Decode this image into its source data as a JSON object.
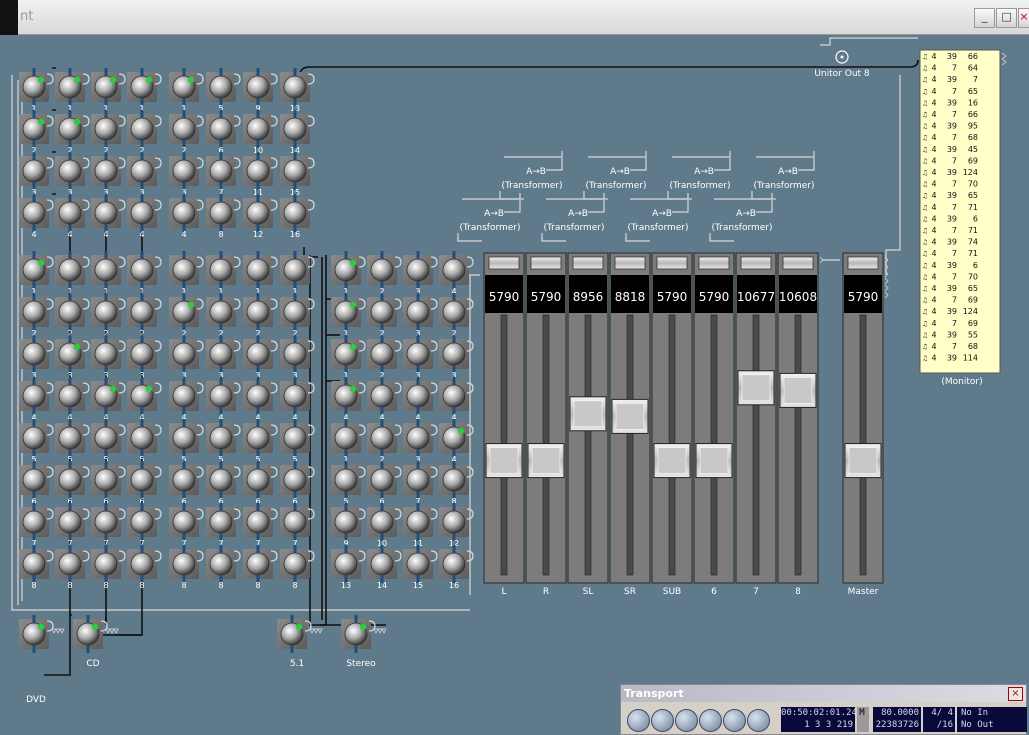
{
  "window": {
    "title": "nt",
    "min_glyph": "_",
    "max_glyph": "□",
    "close_glyph": "×"
  },
  "colors": {
    "background": "#5f7a8a",
    "knob_led": "#2ecc40",
    "fader_panel": "#7c7c7c",
    "readout_bg": "#000000",
    "monitor_bg": "#ffffc8"
  },
  "knob_groups": {
    "block_a_rows": [
      [
        "1",
        "1",
        "1",
        "1"
      ],
      [
        "2",
        "2",
        "2",
        "2"
      ],
      [
        "3",
        "3",
        "3",
        "3"
      ],
      [
        "4",
        "4",
        "4",
        "4"
      ]
    ],
    "block_b_rows": [
      [
        "1",
        "5",
        "9",
        "13"
      ],
      [
        "2",
        "6",
        "10",
        "14"
      ],
      [
        "3",
        "7",
        "11",
        "15"
      ],
      [
        "4",
        "8",
        "12",
        "16"
      ]
    ],
    "block_c_rows": [
      [
        "1",
        "1",
        "1",
        "1"
      ],
      [
        "2",
        "2",
        "2",
        "2"
      ],
      [
        "3",
        "3",
        "3",
        "3"
      ],
      [
        "4",
        "4",
        "4",
        "4"
      ],
      [
        "5",
        "5",
        "5",
        "5"
      ],
      [
        "6",
        "6",
        "6",
        "6"
      ],
      [
        "7",
        "7",
        "7",
        "7"
      ],
      [
        "8",
        "8",
        "8",
        "8"
      ]
    ],
    "block_d_rows": [
      [
        "1",
        "1",
        "1",
        "1"
      ],
      [
        "2",
        "2",
        "2",
        "2"
      ],
      [
        "3",
        "3",
        "3",
        "3"
      ],
      [
        "4",
        "4",
        "4",
        "4"
      ],
      [
        "5",
        "5",
        "5",
        "5"
      ],
      [
        "6",
        "6",
        "6",
        "6"
      ],
      [
        "7",
        "7",
        "7",
        "7"
      ],
      [
        "8",
        "8",
        "8",
        "8"
      ]
    ],
    "block_e_rows": [
      [
        "1",
        "2",
        "3",
        "4"
      ],
      [
        "1",
        "2",
        "3",
        "2"
      ],
      [
        "1",
        "2",
        "3",
        "3"
      ],
      [
        "4",
        "4",
        "4",
        "4"
      ],
      [
        "1",
        "2",
        "3",
        "4"
      ],
      [
        "5",
        "6",
        "7",
        "8"
      ],
      [
        "9",
        "10",
        "11",
        "12"
      ],
      [
        "13",
        "14",
        "15",
        "16"
      ]
    ],
    "block_a_leds": [
      0,
      1,
      2,
      3,
      4,
      5
    ],
    "block_c_leds": [
      0,
      9,
      14,
      15
    ],
    "block_d_leds": [
      4
    ],
    "block_e_leds": [
      0,
      4,
      8,
      12,
      19
    ]
  },
  "sources": [
    {
      "label": "DVD"
    },
    {
      "label": "CD"
    },
    {
      "label": "5.1"
    },
    {
      "label": "Stereo"
    }
  ],
  "unitor_out": "Unitor Out 8",
  "transformer": {
    "glyph": "A→B",
    "label": "(Transformer)"
  },
  "faders": {
    "channels": [
      {
        "label": "L",
        "value": "5790",
        "level": 0.44
      },
      {
        "label": "R",
        "value": "5790",
        "level": 0.44
      },
      {
        "label": "SL",
        "value": "8956",
        "level": 0.62
      },
      {
        "label": "SR",
        "value": "8818",
        "level": 0.61
      },
      {
        "label": "SUB",
        "value": "5790",
        "level": 0.44
      },
      {
        "label": "6",
        "value": "5790",
        "level": 0.44
      },
      {
        "label": "7",
        "value": "10677",
        "level": 0.72
      },
      {
        "label": "8",
        "value": "10608",
        "level": 0.71
      }
    ],
    "master": {
      "label": "Master",
      "value": "5790",
      "level": 0.44
    }
  },
  "monitor": {
    "label": "(Monitor)",
    "rows": [
      [
        "4",
        "39",
        "66"
      ],
      [
        "4",
        "7",
        "64"
      ],
      [
        "4",
        "39",
        "7"
      ],
      [
        "4",
        "7",
        "65"
      ],
      [
        "4",
        "39",
        "16"
      ],
      [
        "4",
        "7",
        "66"
      ],
      [
        "4",
        "39",
        "95"
      ],
      [
        "4",
        "7",
        "68"
      ],
      [
        "4",
        "39",
        "45"
      ],
      [
        "4",
        "7",
        "69"
      ],
      [
        "4",
        "39",
        "124"
      ],
      [
        "4",
        "7",
        "70"
      ],
      [
        "4",
        "39",
        "65"
      ],
      [
        "4",
        "7",
        "71"
      ],
      [
        "4",
        "39",
        "6"
      ],
      [
        "4",
        "7",
        "71"
      ],
      [
        "4",
        "39",
        "74"
      ],
      [
        "4",
        "7",
        "71"
      ],
      [
        "4",
        "39",
        "6"
      ],
      [
        "4",
        "7",
        "70"
      ],
      [
        "4",
        "39",
        "65"
      ],
      [
        "4",
        "7",
        "69"
      ],
      [
        "4",
        "39",
        "124"
      ],
      [
        "4",
        "7",
        "69"
      ],
      [
        "4",
        "39",
        "55"
      ],
      [
        "4",
        "7",
        "68"
      ],
      [
        "4",
        "39",
        "114"
      ]
    ]
  },
  "transport": {
    "title": "Transport",
    "close_glyph": "×",
    "buttons": [
      "record-icon",
      "pause-icon",
      "play-icon",
      "stop-icon",
      "rewind-icon",
      "fast-forward-icon"
    ],
    "smpte": "00:50:02:01.24",
    "bars": "1  3  3  219",
    "tempo": "80.0000",
    "ticks": "22383726",
    "sig_top": "4/ 4",
    "sig_bottom": "/16",
    "midi_in": "No In",
    "midi_out": "No Out",
    "m_label": "M"
  }
}
